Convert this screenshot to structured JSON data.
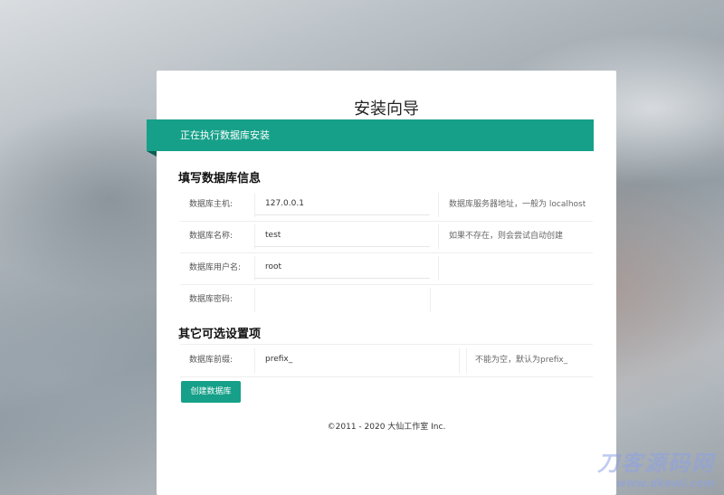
{
  "page": {
    "title": "安装向导",
    "banner": "正在执行数据库安装",
    "footer": "©2011 - 2020 大仙工作室 Inc."
  },
  "db_section": {
    "title": "填写数据库信息",
    "fields": [
      {
        "label": "数据库主机:",
        "value": "127.0.0.1",
        "hint": "数据库服务器地址，一般为 localhost"
      },
      {
        "label": "数据库名称:",
        "value": "test",
        "hint": "如果不存在，则会尝试自动创建"
      },
      {
        "label": "数据库用户名:",
        "value": "root",
        "hint": ""
      },
      {
        "label": "数据库密码:",
        "value": "",
        "hint": ""
      }
    ]
  },
  "optional_section": {
    "title": "其它可选设置项",
    "fields": [
      {
        "label": "数据库前缀:",
        "value": "prefix_",
        "hint": "不能为空，默认为prefix_"
      }
    ]
  },
  "actions": {
    "create_button": "创建数据库"
  },
  "watermark": {
    "name": "刀客源码网",
    "url": "www.dkewl.com"
  },
  "colors": {
    "accent": "#16a089",
    "accent_dark": "#0b5f52"
  }
}
